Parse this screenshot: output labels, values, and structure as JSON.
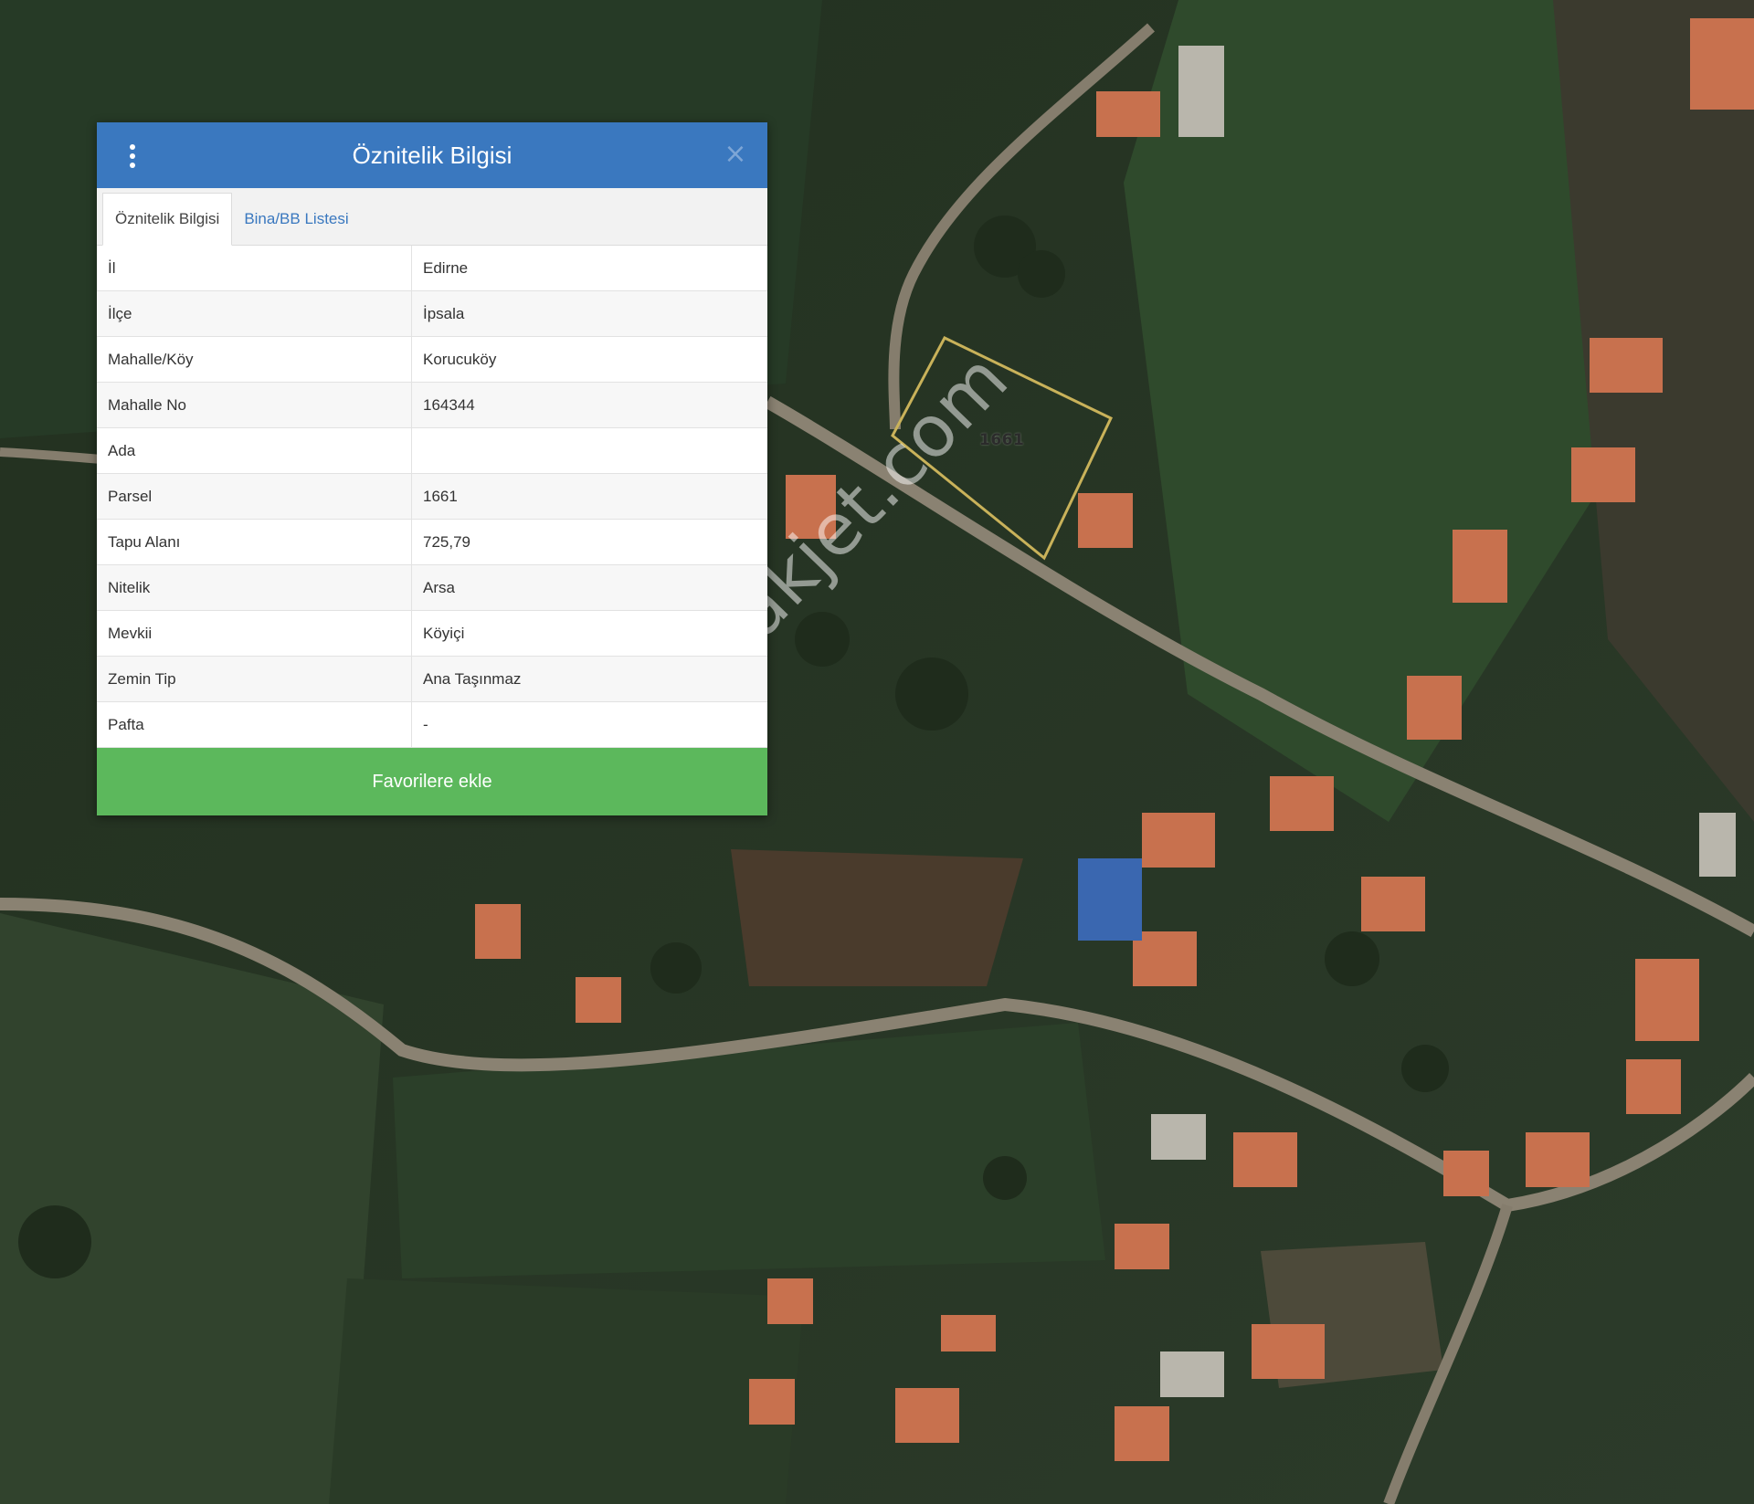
{
  "map": {
    "parcel_label": "1661",
    "watermark": "emlakjet.com",
    "parcel_outline_color": "#c9b25a"
  },
  "panel": {
    "title": "Öznitelik Bilgisi",
    "close_symbol": "×",
    "header_color": "#3a78bf",
    "tabs": [
      {
        "label": "Öznitelik Bilgisi",
        "active": true
      },
      {
        "label": "Bina/BB Listesi",
        "active": false
      }
    ],
    "rows": [
      {
        "key": "İl",
        "value": "Edirne"
      },
      {
        "key": "İlçe",
        "value": "İpsala"
      },
      {
        "key": "Mahalle/Köy",
        "value": "Korucuköy"
      },
      {
        "key": "Mahalle No",
        "value": "164344"
      },
      {
        "key": "Ada",
        "value": ""
      },
      {
        "key": "Parsel",
        "value": "1661"
      },
      {
        "key": "Tapu Alanı",
        "value": "725,79"
      },
      {
        "key": "Nitelik",
        "value": "Arsa"
      },
      {
        "key": "Mevkii",
        "value": "Köyiçi"
      },
      {
        "key": "Zemin Tip",
        "value": "Ana Taşınmaz"
      },
      {
        "key": "Pafta",
        "value": "-"
      }
    ],
    "favorite_label": "Favorilere ekle",
    "favorite_color": "#5cb85c"
  }
}
